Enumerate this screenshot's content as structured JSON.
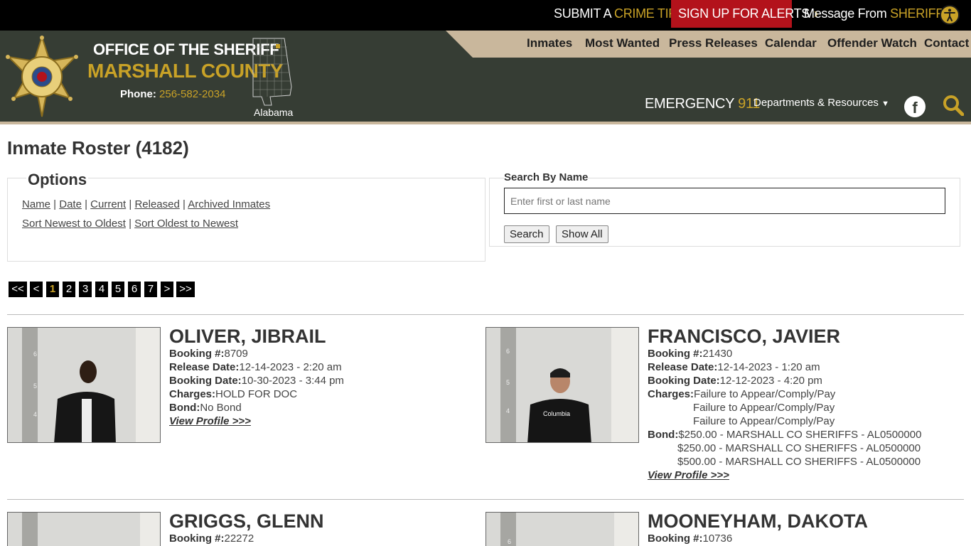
{
  "topbar": {
    "tip_pre": "SUBMIT A",
    "tip_accent": "CRIME TIP",
    "alerts": "SIGN UP FOR ALERTS",
    "msg_pre": "Message From",
    "msg_accent": "SHERIFF",
    "chevron": "›"
  },
  "org": {
    "line1": "OFFICE OF THE SHERIFF",
    "line2": "MARSHALL COUNTY",
    "phone_label": "Phone:",
    "phone": "256-582-2034",
    "state": "Alabama",
    "badge_text": "DEPUTY SHERIFF MARSHALL COUNTY AL"
  },
  "nav": [
    "Inmates",
    "Most Wanted",
    "Press Releases",
    "Calendar",
    "Offender Watch",
    "Contact"
  ],
  "emergency": {
    "label": "EMERGENCY",
    "number": "911"
  },
  "departments": "Departments & Resources",
  "page_title": "Inmate Roster (4182)",
  "options": {
    "legend": "Options",
    "row1": [
      "Name",
      "Date",
      "Current",
      "Released",
      "Archived Inmates"
    ],
    "row2": [
      "Sort Newest to Oldest",
      "Sort Oldest to Newest"
    ]
  },
  "search": {
    "label": "Search By Name",
    "placeholder": "Enter first or last name",
    "search_btn": "Search",
    "show_all_btn": "Show All"
  },
  "pager": [
    "<<",
    "<",
    "1",
    "2",
    "3",
    "4",
    "5",
    "6",
    "7",
    ">",
    ">>"
  ],
  "inmates": [
    {
      "name": "OLIVER, JIBRAIL",
      "booking_label": "Booking #:",
      "booking": "8709",
      "release_label": "Release Date:",
      "release": "12-14-2023 - 2:20 am",
      "bdate_label": "Booking Date:",
      "bdate": "10-30-2023 - 3:44 pm",
      "charges_label": "Charges:",
      "charges": [
        "HOLD FOR DOC"
      ],
      "bond_label": "Bond:",
      "bond": [
        "No Bond"
      ],
      "link": "View Profile >>>"
    },
    {
      "name": "FRANCISCO, JAVIER",
      "booking_label": "Booking #:",
      "booking": "21430",
      "release_label": "Release Date:",
      "release": "12-14-2023 - 1:20 am",
      "bdate_label": "Booking Date:",
      "bdate": "12-12-2023 - 4:20 pm",
      "charges_label": "Charges:",
      "charges": [
        "Failure to Appear/Comply/Pay",
        "Failure to Appear/Comply/Pay",
        "Failure to Appear/Comply/Pay"
      ],
      "bond_label": "Bond:",
      "bond": [
        "$250.00 - MARSHALL CO SHERIFFS - AL0500000",
        "$250.00 - MARSHALL CO SHERIFFS - AL0500000",
        "$500.00 - MARSHALL CO SHERIFFS - AL0500000"
      ],
      "link": "View Profile >>>",
      "shirt_text": "Columbia"
    },
    {
      "name": "GRIGGS, GLENN",
      "booking_label": "Booking #:",
      "booking": "22272"
    },
    {
      "name": "MOONEYHAM, DAKOTA",
      "booking_label": "Booking #:",
      "booking": "10736"
    }
  ]
}
